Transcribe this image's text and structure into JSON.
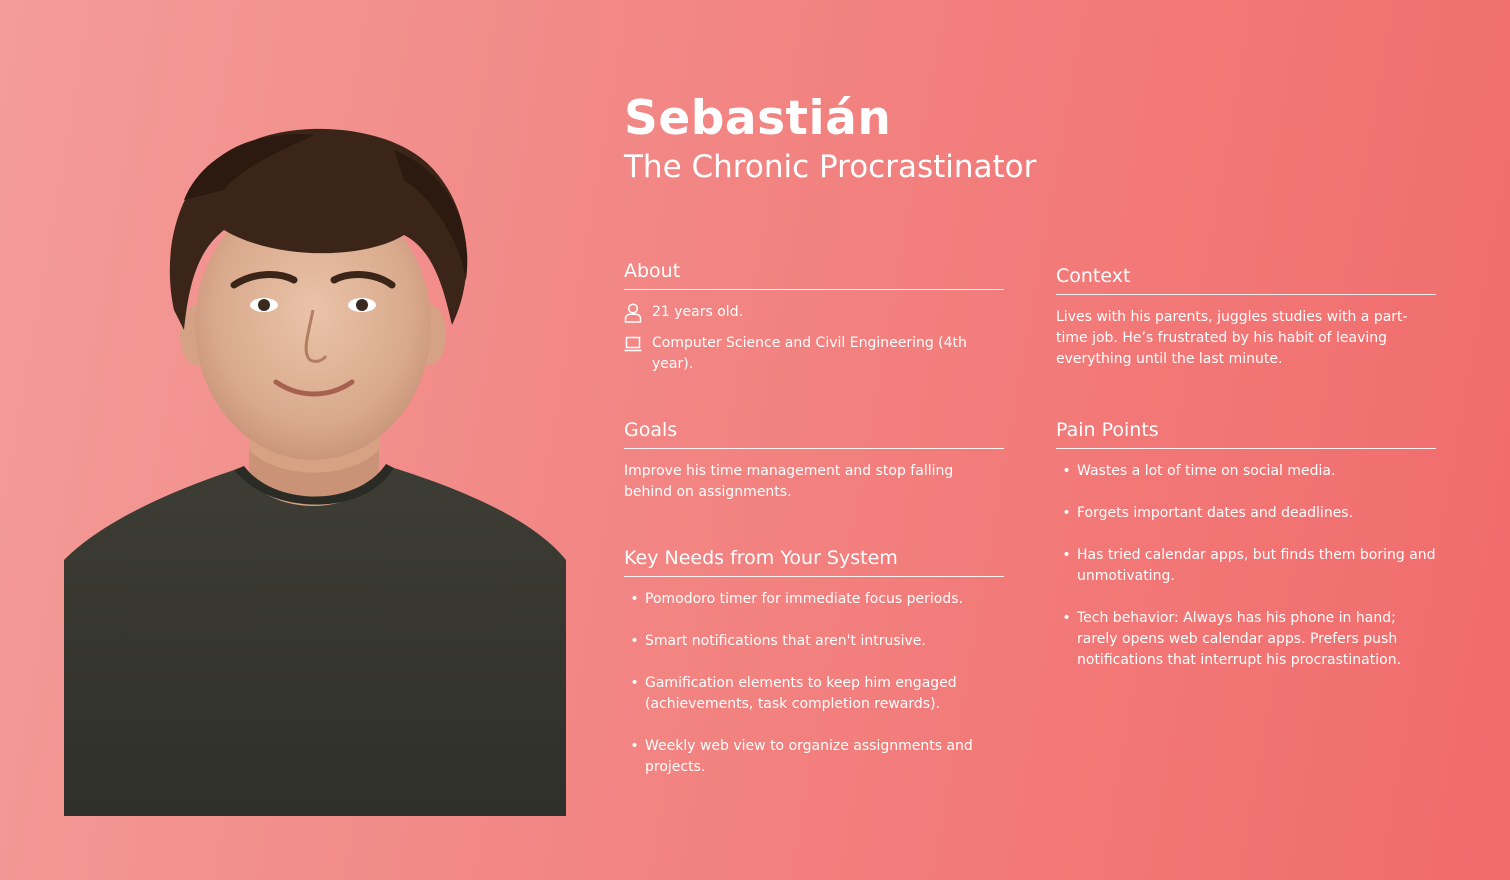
{
  "persona": {
    "name": "Sebastián",
    "archetype": "The Chronic Procrastinator"
  },
  "about": {
    "title": "About",
    "facts": [
      {
        "icon": "person-icon",
        "text": "21 years old."
      },
      {
        "icon": "laptop-icon",
        "text": "Computer Science and Civil Engineering (4th year)."
      }
    ]
  },
  "goals": {
    "title": "Goals",
    "text": "Improve his time management and stop falling behind on assignments."
  },
  "needs": {
    "title": "Key Needs from Your System",
    "items": [
      "Pomodoro timer for immediate focus periods.",
      "Smart notifications that aren't intrusive.",
      "Gamification elements to keep him engaged (achievements, task completion rewards).",
      "Weekly web view to organize assignments and projects."
    ]
  },
  "context": {
    "title": "Context",
    "text": "Lives with his parents, juggles studies with a part-time job. He’s frustrated by his habit of leaving everything until the last minute."
  },
  "pain_points": {
    "title": "Pain Points",
    "items": [
      "Wastes a lot of time on social media.",
      "Forgets important dates and deadlines.",
      "Has tried calendar apps, but finds them boring and unmotivating.",
      "Tech behavior: Always has his phone in hand; rarely opens web calendar apps. Prefers push notifications that interrupt his procrastination."
    ]
  },
  "bullet_glyph": "•",
  "colors": {
    "background_start": "#f39c98",
    "background_end": "#f16b6b",
    "text": "#ffffff",
    "shirt": "#3a3a33"
  }
}
